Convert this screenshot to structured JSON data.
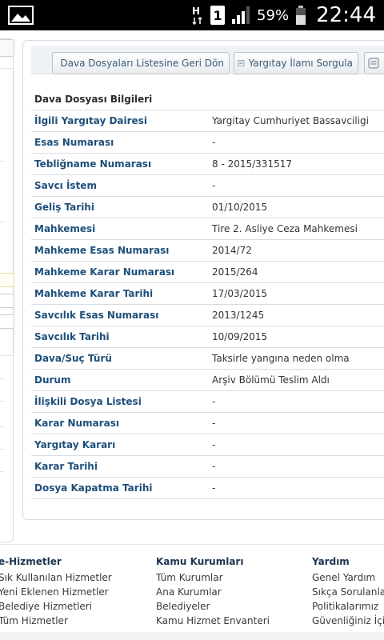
{
  "statusbar": {
    "battery_pct": "59%",
    "time": "22:44",
    "sim_label": "1",
    "network_label": "H"
  },
  "toolbar": {
    "back_label": "Dava Dosyaları Listesine Geri Dön",
    "query_label": "Yargıtay İlamı Sorgula"
  },
  "section_title": "Dava Dosyası Bilgileri",
  "rows": [
    {
      "label": "İlgili Yargıtay Dairesi",
      "value": "Yargitay Cumhuriyet Bassavciligi"
    },
    {
      "label": "Esas Numarası",
      "value": "-"
    },
    {
      "label": "Tebliğname Numarası",
      "value": "8 - 2015/331517"
    },
    {
      "label": "Savcı İstem",
      "value": "-"
    },
    {
      "label": "Geliş Tarihi",
      "value": "01/10/2015"
    },
    {
      "label": "Mahkemesi",
      "value": "Tire 2. Asliye Ceza Mahkemesi"
    },
    {
      "label": "Mahkeme Esas Numarası",
      "value": "2014/72"
    },
    {
      "label": "Mahkeme Karar Numarası",
      "value": "2015/264"
    },
    {
      "label": "Mahkeme Karar Tarihi",
      "value": "17/03/2015"
    },
    {
      "label": "Savcılık Esas Numarası",
      "value": "2013/1245"
    },
    {
      "label": "Savcılık Tarihi",
      "value": "10/09/2015"
    },
    {
      "label": "Dava/Suç Türü",
      "value": "Taksirle yangına neden olma"
    },
    {
      "label": "Durum",
      "value": "Arşiv Bölümü Teslim Aldı"
    },
    {
      "label": "İlişkili Dosya Listesi",
      "value": "-"
    },
    {
      "label": "Karar Numarası",
      "value": "-"
    },
    {
      "label": "Yargıtay Kararı",
      "value": "-"
    },
    {
      "label": "Karar Tarihi",
      "value": "-"
    },
    {
      "label": "Dosya Kapatma Tarihi",
      "value": "-"
    }
  ],
  "footer": {
    "col1": {
      "title": "e-Hizmetler",
      "links": [
        "Sık Kullanılan Hizmetler",
        "Yeni Eklenen Hizmetler",
        "Belediye Hizmetleri",
        "Tüm Hizmetler"
      ]
    },
    "col2": {
      "title": "Kamu Kurumları",
      "links": [
        "Tüm Kurumlar",
        "Ana Kurumlar",
        "Belediyeler",
        "Kamu Hizmet Envanteri"
      ]
    },
    "col3": {
      "title": "Yardım",
      "links": [
        "Genel Yardım",
        "Sıkça Sorulanlar",
        "Politikalarımız",
        "Güvenliğiniz İçin"
      ]
    }
  }
}
